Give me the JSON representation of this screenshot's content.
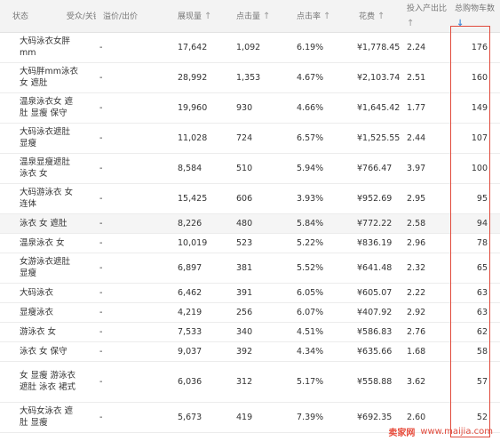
{
  "header": {
    "status": "状态",
    "keyword": "受众/关键词",
    "bid": "溢价/出价",
    "impressions": "展现量",
    "clicks": "点击量",
    "ctr": "点击率",
    "cost": "花费",
    "roi_l1": "投入产出比",
    "purchases_l1": "总购物车数",
    "sort_arrow": "↑",
    "sort_arrow_active": "↓"
  },
  "rows": [
    {
      "keyword": "大码泳衣女胖mm",
      "c1": "-",
      "impressions": "17,642",
      "clicks": "1,092",
      "ctr": "6.19%",
      "cost": "¥1,778.45",
      "roi": "2.24",
      "purchases": "176"
    },
    {
      "keyword": "大码胖mm泳衣 女 遮肚",
      "c1": "-",
      "impressions": "28,992",
      "clicks": "1,353",
      "ctr": "4.67%",
      "cost": "¥2,103.74",
      "roi": "2.51",
      "purchases": "160"
    },
    {
      "keyword": "温泉泳衣女 遮肚 显瘦 保守",
      "c1": "-",
      "impressions": "19,960",
      "clicks": "930",
      "ctr": "4.66%",
      "cost": "¥1,645.42",
      "roi": "1.77",
      "purchases": "149"
    },
    {
      "keyword": "大码泳衣遮肚 显瘦",
      "c1": "-",
      "impressions": "11,028",
      "clicks": "724",
      "ctr": "6.57%",
      "cost": "¥1,525.55",
      "roi": "2.44",
      "purchases": "107"
    },
    {
      "keyword": "温泉显瘦遮肚 泳衣 女",
      "c1": "-",
      "impressions": "8,584",
      "clicks": "510",
      "ctr": "5.94%",
      "cost": "¥766.47",
      "roi": "3.97",
      "purchases": "100"
    },
    {
      "keyword": "大码游泳衣 女 连体",
      "c1": "-",
      "impressions": "15,425",
      "clicks": "606",
      "ctr": "3.93%",
      "cost": "¥952.69",
      "roi": "2.95",
      "purchases": "95"
    },
    {
      "keyword": "泳衣 女 遮肚",
      "c1": "-",
      "impressions": "8,226",
      "clicks": "480",
      "ctr": "5.84%",
      "cost": "¥772.22",
      "roi": "2.58",
      "purchases": "94"
    },
    {
      "keyword": "温泉泳衣 女",
      "c1": "-",
      "impressions": "10,019",
      "clicks": "523",
      "ctr": "5.22%",
      "cost": "¥836.19",
      "roi": "2.96",
      "purchases": "78"
    },
    {
      "keyword": "女游泳衣遮肚 显瘦",
      "c1": "-",
      "impressions": "6,897",
      "clicks": "381",
      "ctr": "5.52%",
      "cost": "¥641.48",
      "roi": "2.32",
      "purchases": "65"
    },
    {
      "keyword": "大码泳衣",
      "c1": "-",
      "impressions": "6,462",
      "clicks": "391",
      "ctr": "6.05%",
      "cost": "¥605.07",
      "roi": "2.22",
      "purchases": "63"
    },
    {
      "keyword": "显瘦泳衣",
      "c1": "-",
      "impressions": "4,219",
      "clicks": "256",
      "ctr": "6.07%",
      "cost": "¥407.92",
      "roi": "2.92",
      "purchases": "63"
    },
    {
      "keyword": "游泳衣 女",
      "c1": "-",
      "impressions": "7,533",
      "clicks": "340",
      "ctr": "4.51%",
      "cost": "¥586.83",
      "roi": "2.76",
      "purchases": "62"
    },
    {
      "keyword": "泳衣 女 保守",
      "c1": "-",
      "impressions": "9,037",
      "clicks": "392",
      "ctr": "4.34%",
      "cost": "¥635.66",
      "roi": "1.68",
      "purchases": "58"
    },
    {
      "keyword": "女 显瘦 游泳衣 遮肚 泳衣 裙式",
      "c1": "-",
      "impressions": "6,036",
      "clicks": "312",
      "ctr": "5.17%",
      "cost": "¥558.88",
      "roi": "3.62",
      "purchases": "57"
    },
    {
      "keyword": "大码女泳衣 遮肚 显瘦",
      "c1": "-",
      "impressions": "5,673",
      "clicks": "419",
      "ctr": "7.39%",
      "cost": "¥692.35",
      "roi": "2.60",
      "purchases": "52"
    }
  ],
  "watermark": {
    "logo": "卖家网",
    "url": "www.maijia.com"
  },
  "colors": {
    "highlight_box": "#e04a3c",
    "active_sort": "#3f8ad9",
    "header_bg": "#f3f3f3",
    "hover_row": "#f5f5f5"
  }
}
